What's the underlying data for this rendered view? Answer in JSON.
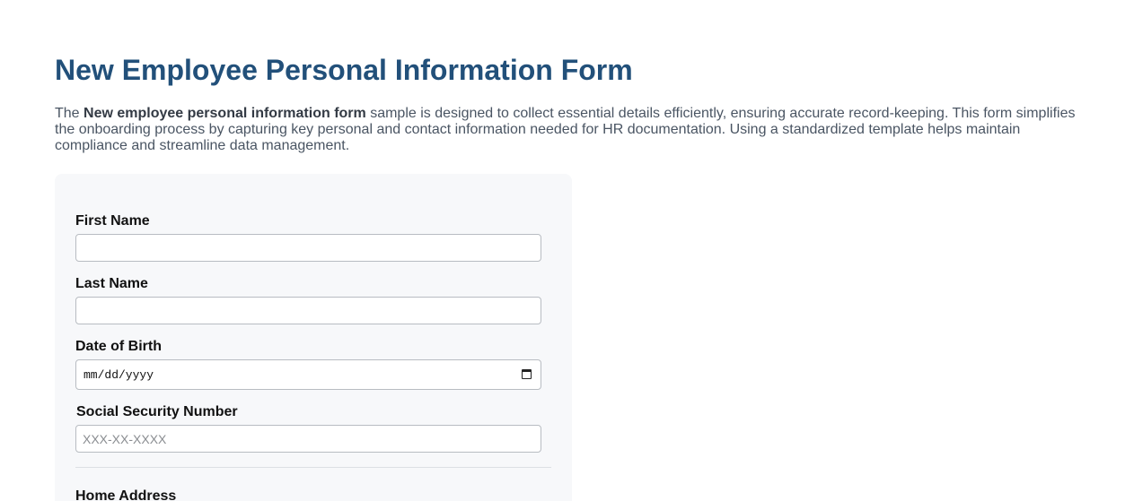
{
  "page": {
    "title": "New Employee Personal Information Form",
    "intro_prefix": "The ",
    "intro_bold": "New employee personal information form",
    "intro_suffix": " sample is designed to collect essential details efficiently, ensuring accurate record-keeping. This form simplifies the onboarding process by capturing key personal and contact information needed for HR documentation. Using a standardized template helps maintain compliance and streamline data management."
  },
  "form": {
    "first_name": {
      "label": "First Name",
      "value": "",
      "placeholder": ""
    },
    "last_name": {
      "label": "Last Name",
      "value": "",
      "placeholder": ""
    },
    "date_of_birth": {
      "label": "Date of Birth",
      "format_hint": "mm/dd/yyyy",
      "icon": "calendar-icon"
    },
    "ssn": {
      "label": "Social Security Number",
      "value": "",
      "placeholder": "XXX-XX-XXXX"
    },
    "home_address": {
      "label": "Home Address"
    }
  }
}
